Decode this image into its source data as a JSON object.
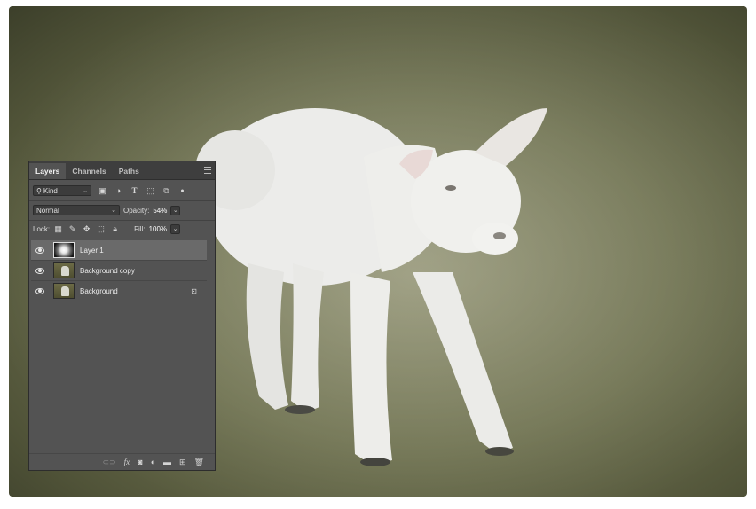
{
  "panel": {
    "tabs": [
      "Layers",
      "Channels",
      "Paths"
    ],
    "filter": {
      "kind_label": "Kind",
      "icons": [
        "image-filter-icon",
        "adjustment-filter-icon",
        "type-filter-icon",
        "shape-filter-icon",
        "smart-object-filter-icon",
        "filter-toggle-icon"
      ]
    },
    "blend_mode": "Normal",
    "opacity_label": "Opacity:",
    "opacity_value": "54%",
    "lock_label": "Lock:",
    "lock_icons": [
      "lock-transparent-icon",
      "lock-image-icon",
      "lock-position-icon",
      "lock-artboard-icon",
      "lock-all-icon"
    ],
    "fill_label": "Fill:",
    "fill_value": "100%",
    "layers": [
      {
        "name": "Layer 1",
        "selected": true,
        "locked": false,
        "thumb": "gradient-mask"
      },
      {
        "name": "Background copy",
        "selected": false,
        "locked": false,
        "thumb": "lamb-photo"
      },
      {
        "name": "Background",
        "selected": false,
        "locked": true,
        "thumb": "lamb-photo"
      }
    ],
    "footer_icons": [
      "link-icon",
      "fx-icon",
      "mask-icon",
      "adjustment-icon",
      "folder-icon",
      "new-layer-icon",
      "trash-icon"
    ]
  },
  "colors": {
    "panel_bg": "#535353",
    "tab_bar_bg": "#3e3e3e",
    "selected_layer": "#6a6a6a",
    "photo_grass": "#6f7250"
  }
}
